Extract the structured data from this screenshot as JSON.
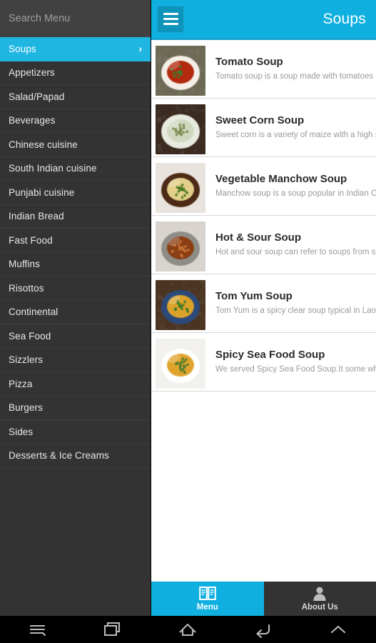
{
  "colors": {
    "accent": "#0fb0e0",
    "sidebar_bg": "#333333",
    "sidebar_search_bg": "#414141",
    "sidebar_active": "#20b6e2",
    "content_bg": "#ffffff",
    "title_text": "#2a2a2a",
    "desc_text": "#9a9a9a",
    "navbar_bg": "#000000"
  },
  "sidebar": {
    "search": {
      "placeholder": "Search Menu",
      "value": "",
      "icon": "search-icon"
    },
    "items": [
      {
        "label": "Soups",
        "active": true,
        "chevron": "›"
      },
      {
        "label": "Appetizers",
        "active": false,
        "chevron": ""
      },
      {
        "label": "Salad/Papad",
        "active": false,
        "chevron": ""
      },
      {
        "label": "Beverages",
        "active": false,
        "chevron": ""
      },
      {
        "label": "Chinese cuisine",
        "active": false,
        "chevron": ""
      },
      {
        "label": "South Indian cuisine",
        "active": false,
        "chevron": ""
      },
      {
        "label": "Punjabi cuisine",
        "active": false,
        "chevron": ""
      },
      {
        "label": "Indian Bread",
        "active": false,
        "chevron": ""
      },
      {
        "label": "Fast Food",
        "active": false,
        "chevron": ""
      },
      {
        "label": "Muffins",
        "active": false,
        "chevron": ""
      },
      {
        "label": "Risottos",
        "active": false,
        "chevron": ""
      },
      {
        "label": "Continental",
        "active": false,
        "chevron": ""
      },
      {
        "label": "Sea Food",
        "active": false,
        "chevron": ""
      },
      {
        "label": "Sizzlers",
        "active": false,
        "chevron": ""
      },
      {
        "label": "Pizza",
        "active": false,
        "chevron": ""
      },
      {
        "label": "Burgers",
        "active": false,
        "chevron": ""
      },
      {
        "label": "Sides",
        "active": false,
        "chevron": ""
      },
      {
        "label": "Desserts & Ice Creams",
        "active": false,
        "chevron": ""
      }
    ]
  },
  "appbar": {
    "menu_icon": "hamburger-icon",
    "title": "Soups"
  },
  "items": [
    {
      "title": "Tomato Soup",
      "desc": "Tomato soup is a soup made with tomatoes as t",
      "thumb": "tomato-soup-thumbnail",
      "thumb_colors": [
        "#6c6a55",
        "#f4efe6",
        "#b3290f",
        "#3f7a2a"
      ]
    },
    {
      "title": "Sweet Corn Soup",
      "desc": "Sweet corn is a variety of maize with a high suga",
      "thumb": "sweet-corn-soup-thumbnail",
      "thumb_colors": [
        "#3a2a20",
        "#e9eadf",
        "#cfd8bf",
        "#7b8a4e"
      ]
    },
    {
      "title": "Vegetable Manchow Soup",
      "desc": "Manchow soup is a soup popular in Indian Chine",
      "thumb": "vegetable-manchow-soup-thumbnail",
      "thumb_colors": [
        "#e8e4dd",
        "#4d2a16",
        "#e3cf8a",
        "#4e7a28"
      ]
    },
    {
      "title": "Hot & Sour Soup",
      "desc": "Hot and sour soup can refer to soups from sever",
      "thumb": "hot-and-sour-soup-thumbnail",
      "thumb_colors": [
        "#d8d4cd",
        "#8e8d88",
        "#8a3f14",
        "#c9733a"
      ]
    },
    {
      "title": "Tom Yum Soup",
      "desc": "Tom Yum is a spicy clear soup typical in Laos ar",
      "thumb": "tom-yum-soup-thumbnail",
      "thumb_colors": [
        "#4b3522",
        "#2b4a7a",
        "#dba22a",
        "#3f7a2a"
      ]
    },
    {
      "title": "Spicy Sea Food Soup",
      "desc": "We served Spicy Sea Food Soup.It some what sp",
      "thumb": "spicy-sea-food-soup-thumbnail",
      "thumb_colors": [
        "#f2f1ee",
        "#ffffff",
        "#e0a42c",
        "#4a7a2c"
      ]
    }
  ],
  "tabbar": {
    "tabs": [
      {
        "label": "Menu",
        "icon": "book-icon",
        "active": true
      },
      {
        "label": "About Us",
        "icon": "person-icon",
        "active": false
      }
    ]
  },
  "navbar": {
    "buttons": [
      {
        "name": "menu-icon"
      },
      {
        "name": "recent-apps-icon"
      },
      {
        "name": "home-icon"
      },
      {
        "name": "back-icon"
      },
      {
        "name": "expand-up-icon"
      }
    ]
  }
}
